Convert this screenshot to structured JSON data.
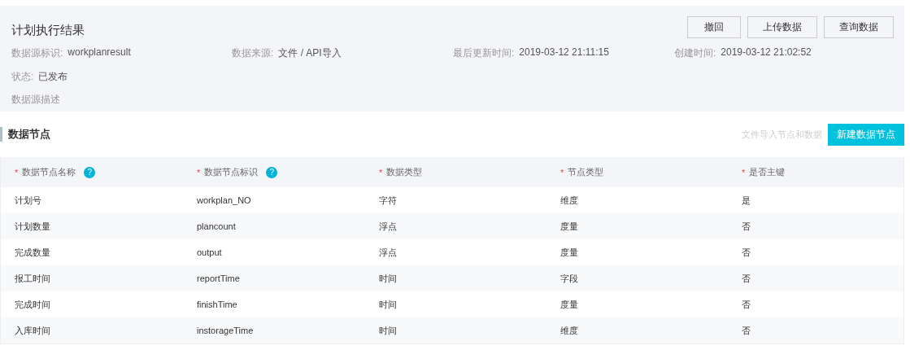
{
  "header": {
    "title": "计划执行结果",
    "actions": [
      "撤回",
      "上传数据",
      "查询数据"
    ],
    "fields": [
      {
        "label": "数据源标识:",
        "value": "workplanresult"
      },
      {
        "label": "数据来源:",
        "value": "文件 / API导入"
      },
      {
        "label": "最后更新时间:",
        "value": "2019-03-12 21:11:15"
      },
      {
        "label": "创建时间:",
        "value": "2019-03-12 21:02:52"
      }
    ],
    "status": {
      "label": "状态:",
      "value": "已发布"
    },
    "description_label": "数据源描述"
  },
  "section": {
    "title": "数据节点",
    "import_link": "文件导入节点和数据",
    "new_button": "新建数据节点"
  },
  "table": {
    "required_mark": "*",
    "columns": [
      {
        "label": "数据节点名称",
        "required": true,
        "help": "?"
      },
      {
        "label": "数据节点标识",
        "required": true,
        "help": "?"
      },
      {
        "label": "数据类型",
        "required": true
      },
      {
        "label": "节点类型",
        "required": true
      },
      {
        "label": "是否主键",
        "required": true
      }
    ],
    "rows": [
      [
        "计划号",
        "workplan_NO",
        "字符",
        "维度",
        "是"
      ],
      [
        "计划数量",
        "plancount",
        "浮点",
        "度量",
        "否"
      ],
      [
        "完成数量",
        "output",
        "浮点",
        "度量",
        "否"
      ],
      [
        "报工时间",
        "reportTime",
        "时间",
        "字段",
        "否"
      ],
      [
        "完成时间",
        "finishTime",
        "时间",
        "度量",
        "否"
      ],
      [
        "入库时间",
        "instorageTime",
        "时间",
        "维度",
        "否"
      ]
    ]
  }
}
